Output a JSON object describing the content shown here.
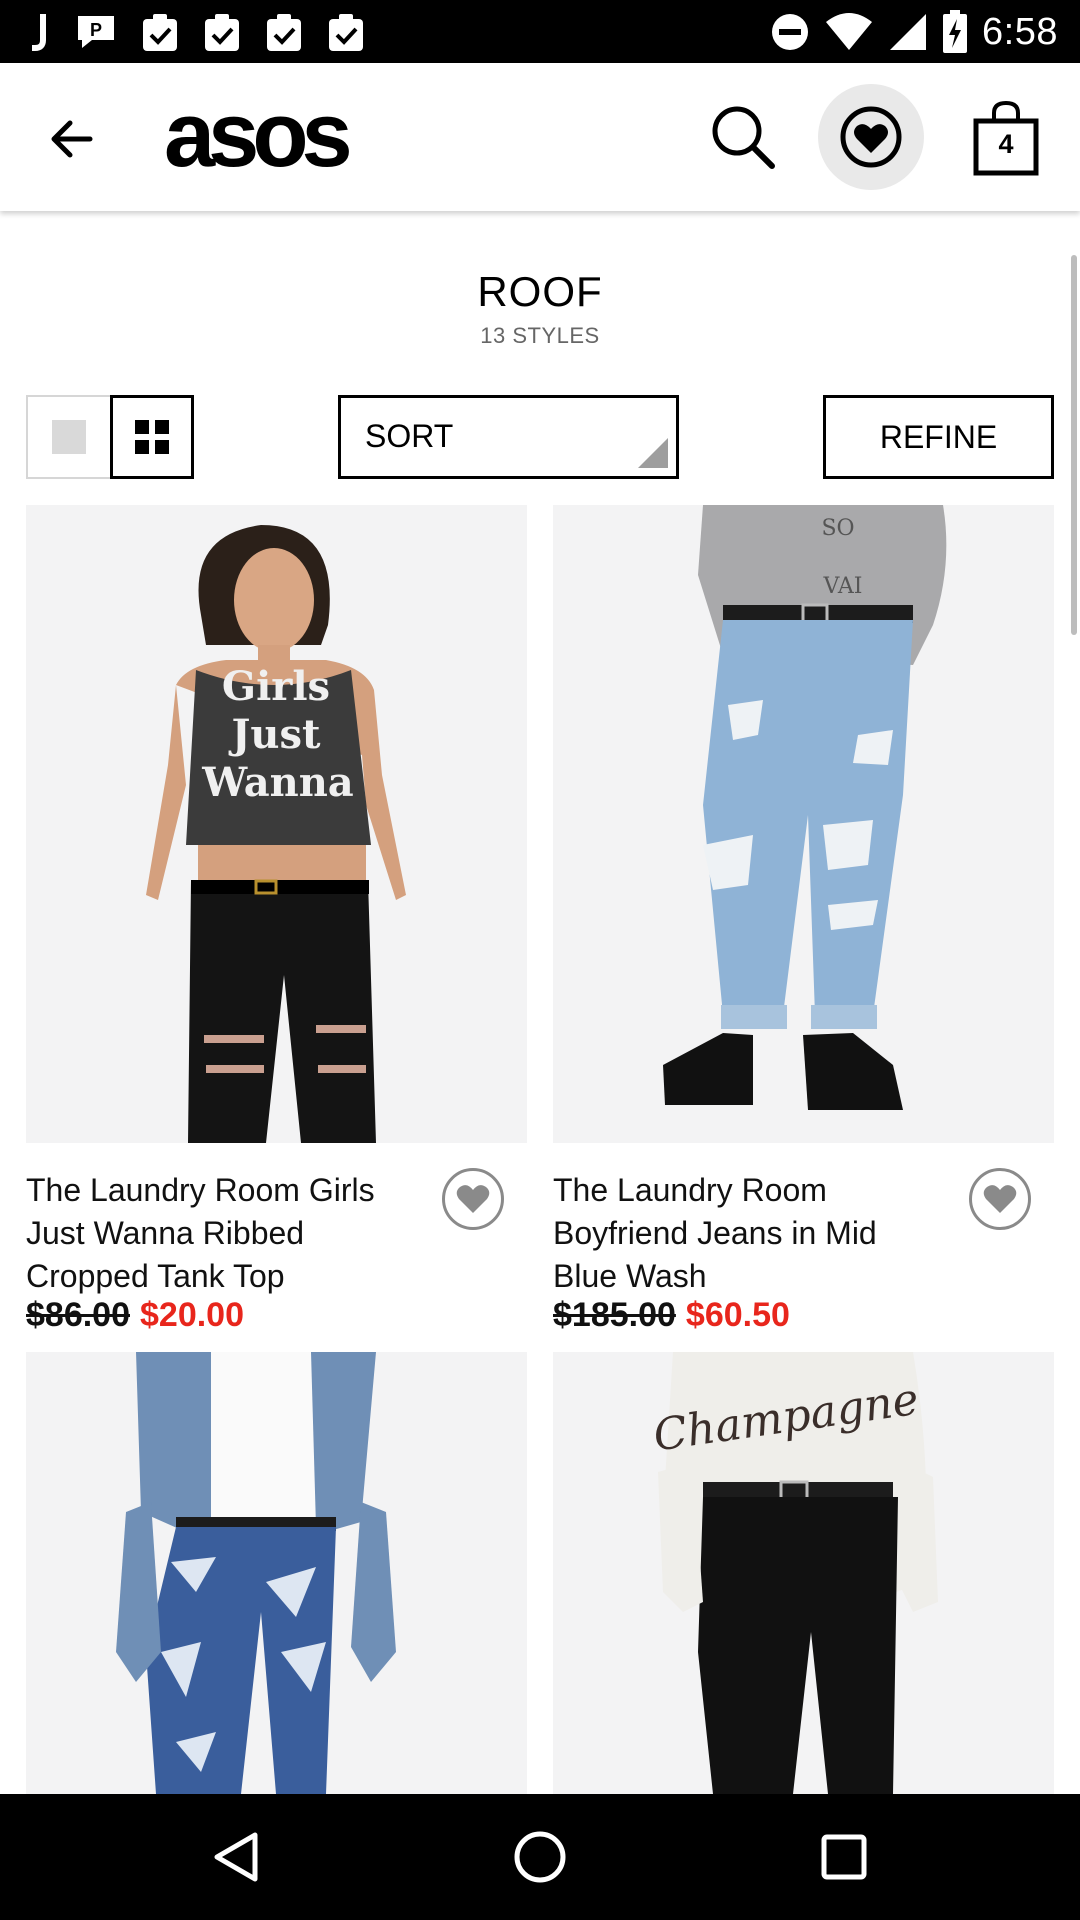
{
  "status_bar": {
    "time": "6:58",
    "left_icons": [
      "j-app-icon",
      "message-icon",
      "clipboard-check-icon",
      "clipboard-check-icon",
      "clipboard-check-icon",
      "clipboard-check-icon"
    ],
    "right_icons": [
      "do-not-disturb-icon",
      "wifi-icon",
      "signal-icon",
      "battery-charging-icon"
    ]
  },
  "app_bar": {
    "logo": "asos",
    "back_icon": "arrow-back-icon",
    "search_icon": "search-icon",
    "saved_icon": "heart-icon",
    "bag_icon": "shopping-bag-icon",
    "bag_count": "4"
  },
  "page": {
    "title": "ROOF",
    "styles_count": "13 STYLES"
  },
  "controls": {
    "sort_label": "SORT",
    "refine_label": "REFINE",
    "view_single_icon": "single-view-icon",
    "view_grid_icon": "grid-view-icon"
  },
  "products": [
    {
      "name": "The Laundry Room Girls Just Wanna Ribbed Cropped Tank Top",
      "was_price": "$86.00",
      "now_price": "$20.00",
      "image_text": [
        "Girls",
        "Just",
        "Wanna"
      ]
    },
    {
      "name": "The Laundry Room Boyfriend Jeans in Mid Blue Wash",
      "was_price": "$185.00",
      "now_price": "$60.50",
      "image_text": [
        "SO",
        "VAI"
      ]
    },
    {
      "name": "",
      "image_text": []
    },
    {
      "name": "",
      "image_text": [
        "Champagne"
      ]
    }
  ],
  "colors": {
    "sale_red": "#e8261c",
    "image_bg": "#f3f3f4",
    "black": "#000000"
  },
  "nav_bar": {
    "back_icon": "nav-back-icon",
    "home_icon": "nav-home-icon",
    "recents_icon": "nav-recents-icon"
  }
}
